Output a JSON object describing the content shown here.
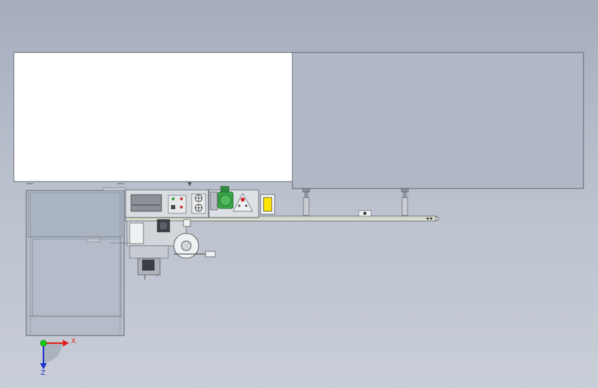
{
  "viewport": {
    "background_top": "#a5adbd",
    "background_bottom": "#c9ced8"
  },
  "axes_triad": {
    "x_label": "X",
    "z_label": "Z",
    "x_color": "#e0201a",
    "z_color": "#2233cc",
    "origin_color": "#14c814"
  },
  "colors": {
    "outline": "#5c6470",
    "white_panel": "#ffffff",
    "grey_panel": "#b1b8c6",
    "motor_green": "#3aa64a",
    "indicator_yellow": "#ffe600",
    "cabinet_fill": "#b3bcc8",
    "light_grey": "#d6dadf"
  }
}
